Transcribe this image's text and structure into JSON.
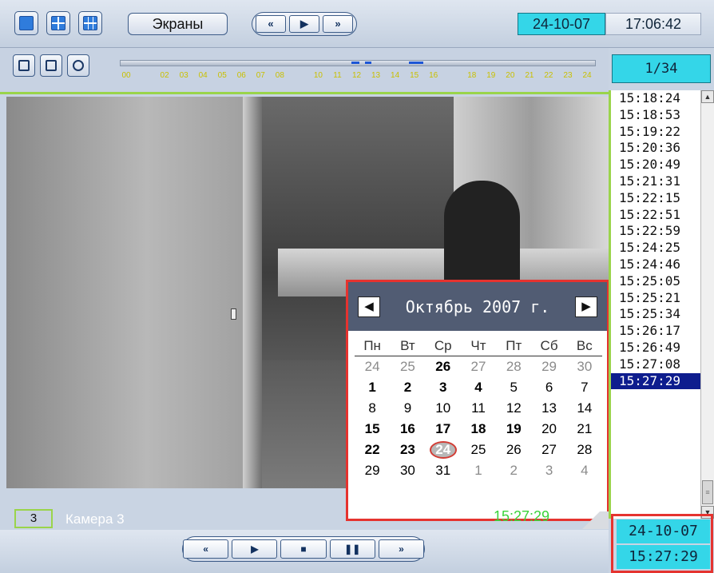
{
  "topbar": {
    "screens_label": "Экраны",
    "nav_prev": "«",
    "nav_play": "▶",
    "nav_next": "»",
    "date": "24-10-07",
    "time": "17:06:42"
  },
  "timeline": {
    "labels": [
      "00",
      "02",
      "03",
      "04",
      "05",
      "06",
      "07",
      "08",
      "10",
      "11",
      "12",
      "13",
      "14",
      "15",
      "16",
      "18",
      "19",
      "20",
      "21",
      "22",
      "23",
      "24"
    ]
  },
  "video": {
    "camera_number": "3",
    "camera_name": "Камера 3",
    "overlay_time": "15:27:29"
  },
  "calendar": {
    "month_title": "Октябрь 2007 г.",
    "prev_icon": "◀",
    "next_icon": "▶",
    "weekdays": [
      "Пн",
      "Вт",
      "Ср",
      "Чт",
      "Пт",
      "Сб",
      "Вс"
    ],
    "weeks": [
      [
        {
          "d": "24",
          "s": "dim"
        },
        {
          "d": "25",
          "s": "dim"
        },
        {
          "d": "26",
          "s": "bold"
        },
        {
          "d": "27",
          "s": "dim"
        },
        {
          "d": "28",
          "s": "dim"
        },
        {
          "d": "29",
          "s": "dim"
        },
        {
          "d": "30",
          "s": "dim"
        }
      ],
      [
        {
          "d": "1",
          "s": "bold"
        },
        {
          "d": "2",
          "s": "bold"
        },
        {
          "d": "3",
          "s": "bold"
        },
        {
          "d": "4",
          "s": "bold"
        },
        {
          "d": "5",
          "s": ""
        },
        {
          "d": "6",
          "s": ""
        },
        {
          "d": "7",
          "s": ""
        }
      ],
      [
        {
          "d": "8",
          "s": ""
        },
        {
          "d": "9",
          "s": ""
        },
        {
          "d": "10",
          "s": ""
        },
        {
          "d": "11",
          "s": ""
        },
        {
          "d": "12",
          "s": ""
        },
        {
          "d": "13",
          "s": ""
        },
        {
          "d": "14",
          "s": ""
        }
      ],
      [
        {
          "d": "15",
          "s": "bold"
        },
        {
          "d": "16",
          "s": "bold"
        },
        {
          "d": "17",
          "s": "bold"
        },
        {
          "d": "18",
          "s": "bold"
        },
        {
          "d": "19",
          "s": "bold"
        },
        {
          "d": "20",
          "s": ""
        },
        {
          "d": "21",
          "s": ""
        }
      ],
      [
        {
          "d": "22",
          "s": "bold"
        },
        {
          "d": "23",
          "s": "bold"
        },
        {
          "d": "24",
          "s": "today"
        },
        {
          "d": "25",
          "s": ""
        },
        {
          "d": "26",
          "s": ""
        },
        {
          "d": "27",
          "s": ""
        },
        {
          "d": "28",
          "s": ""
        }
      ],
      [
        {
          "d": "29",
          "s": ""
        },
        {
          "d": "30",
          "s": ""
        },
        {
          "d": "31",
          "s": ""
        },
        {
          "d": "1",
          "s": "dim"
        },
        {
          "d": "2",
          "s": "dim"
        },
        {
          "d": "3",
          "s": "dim"
        },
        {
          "d": "4",
          "s": "dim"
        }
      ]
    ]
  },
  "player": {
    "rewind": "«",
    "play": "▶",
    "stop": "■",
    "pause": "❚❚",
    "forward": "»"
  },
  "right_panel": {
    "counter": "1/34",
    "times": [
      "15:18:24",
      "15:18:53",
      "15:19:22",
      "15:20:36",
      "15:20:49",
      "15:21:31",
      "15:22:15",
      "15:22:51",
      "15:22:59",
      "15:24:25",
      "15:24:46",
      "15:25:05",
      "15:25:21",
      "15:25:34",
      "15:26:17",
      "15:26:49",
      "15:27:08",
      "15:27:29"
    ],
    "selected_time": "15:27:29",
    "bottom_date": "24-10-07",
    "bottom_time": "15:27:29"
  }
}
